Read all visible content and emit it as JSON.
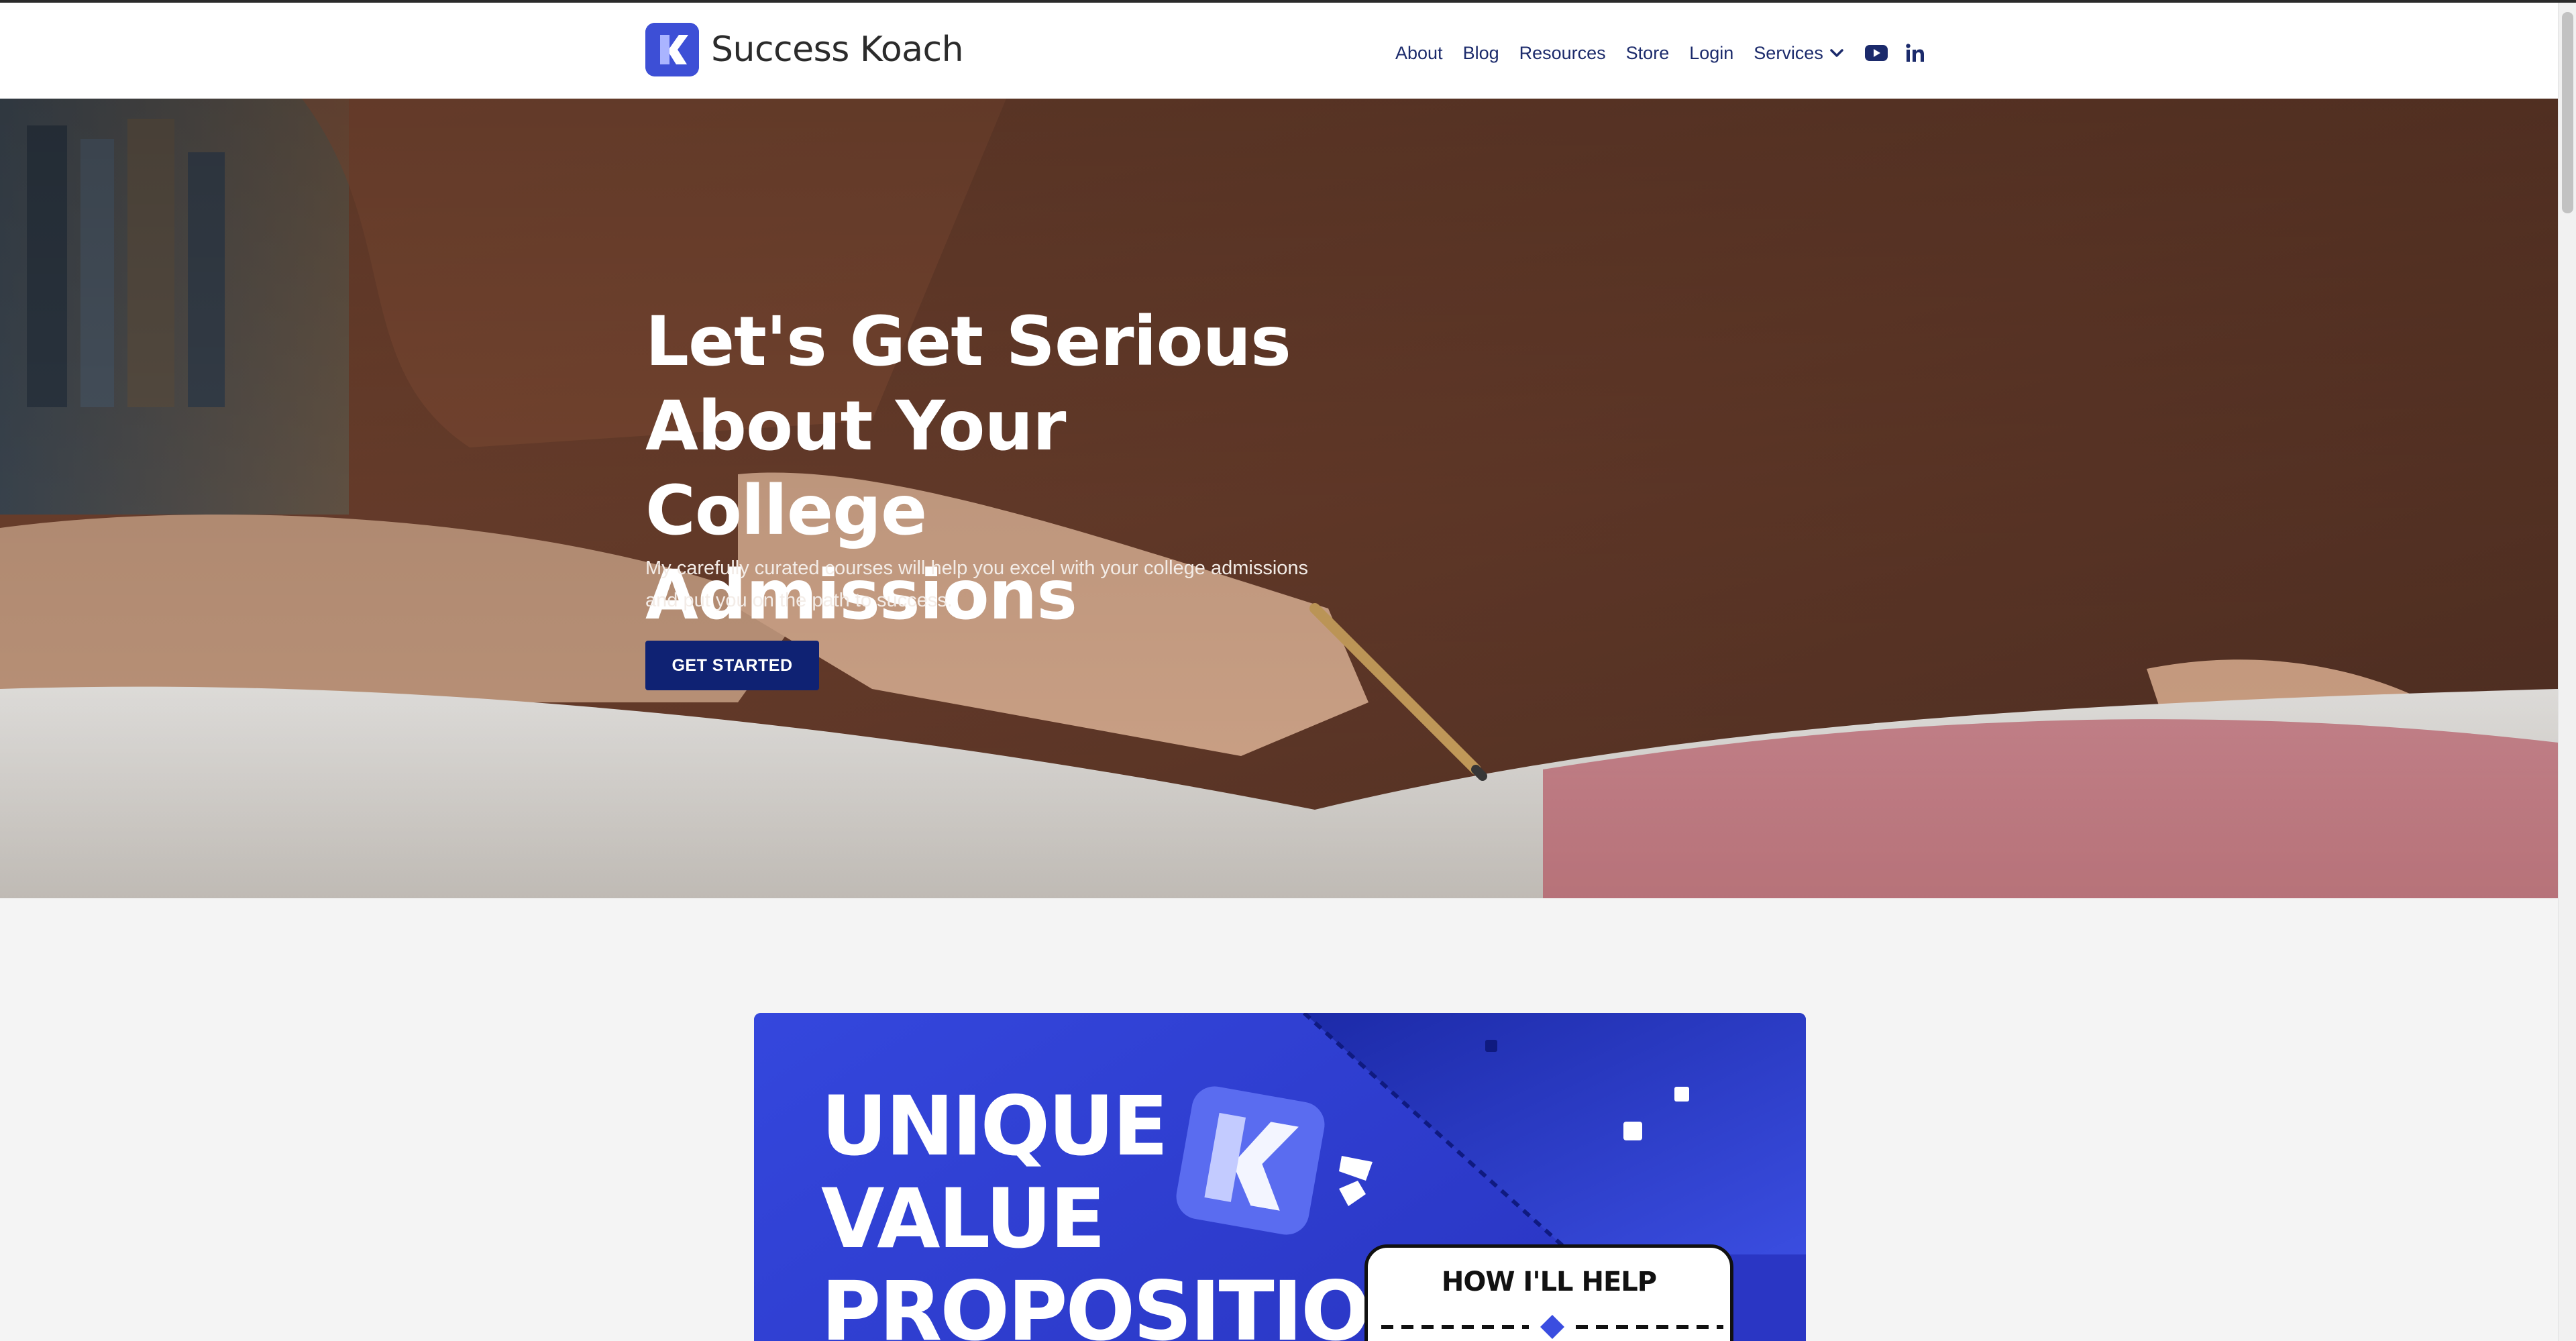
{
  "brand": {
    "name": "Success Koach",
    "logo_color": "#3d4fd6"
  },
  "nav": {
    "items": [
      "About",
      "Blog",
      "Resources",
      "Store",
      "Login"
    ],
    "services_label": "Services",
    "youtube_icon": "youtube-icon",
    "linkedin_icon": "linkedin-icon",
    "text_color": "#1b2a6b"
  },
  "hero": {
    "title": "Let's Get Serious About Your College Admissions",
    "subtitle": "My carefully curated courses will help you excel with your college admissions and put you on the path to success.",
    "cta_label": "GET STARTED",
    "cta_color": "#0f2273"
  },
  "promo": {
    "title": "UNIQUE VALUE PROPOSITION",
    "card_title": "HOW I'LL HELP",
    "accent": "#3a4de0"
  }
}
